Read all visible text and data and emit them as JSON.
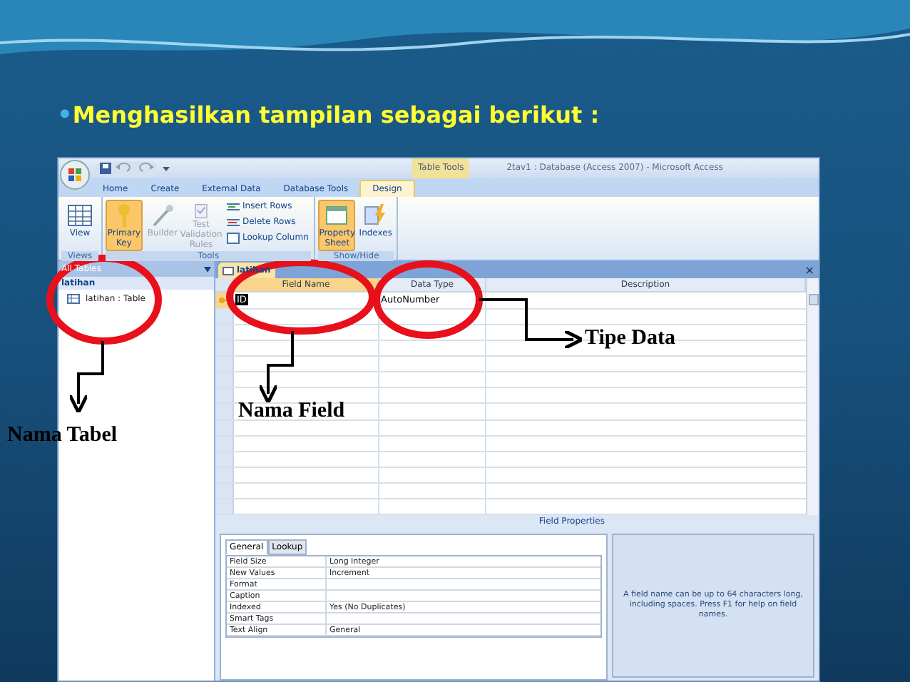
{
  "slide": {
    "bullet": "•",
    "title": "Menghasilkan tampilan sebagai berikut :"
  },
  "window": {
    "context_tab": "Table Tools",
    "title": "2tav1 : Database (Access 2007) - Microsoft Access"
  },
  "ribbon_tabs": [
    {
      "label": "Home",
      "selected": false
    },
    {
      "label": "Create",
      "selected": false
    },
    {
      "label": "External Data",
      "selected": false
    },
    {
      "label": "Database Tools",
      "selected": false
    },
    {
      "label": "Design",
      "selected": true
    }
  ],
  "ribbon_groups": [
    {
      "label": "Views",
      "buttons": [
        {
          "kind": "large",
          "label": "View",
          "active": false,
          "disabled": false
        }
      ]
    },
    {
      "label": "Tools",
      "buttons": [
        {
          "kind": "large",
          "label": "Primary Key",
          "active": true,
          "disabled": false
        },
        {
          "kind": "large",
          "label": "Builder",
          "active": false,
          "disabled": true
        },
        {
          "kind": "large",
          "label": "Test Validation Rules",
          "active": false,
          "disabled": true
        },
        {
          "kind": "small",
          "label": "Insert Rows",
          "active": false,
          "disabled": false
        },
        {
          "kind": "small",
          "label": "Delete Rows",
          "active": false,
          "disabled": false
        },
        {
          "kind": "small",
          "label": "Lookup Column",
          "active": false,
          "disabled": false
        }
      ]
    },
    {
      "label": "Show/Hide",
      "buttons": [
        {
          "kind": "large",
          "label": "Property Sheet",
          "active": true,
          "disabled": false
        },
        {
          "kind": "large",
          "label": "Indexes",
          "active": false,
          "disabled": false
        }
      ]
    }
  ],
  "nav_pane": {
    "header": "All Tables",
    "group": "latihan",
    "items": [
      {
        "label": "latihan : Table"
      }
    ]
  },
  "document_tab": {
    "label": "latihan",
    "close": "×"
  },
  "design_grid": {
    "columns": [
      "Field Name",
      "Data Type",
      "Description"
    ],
    "rows": [
      {
        "field_name": "ID",
        "data_type": "AutoNumber",
        "primary_key": true,
        "selected": true
      }
    ]
  },
  "field_properties": {
    "title": "Field Properties",
    "tabs": [
      {
        "label": "General",
        "selected": true
      },
      {
        "label": "Lookup",
        "selected": false
      }
    ],
    "properties": [
      {
        "name": "Field Size",
        "value": "Long Integer"
      },
      {
        "name": "New Values",
        "value": "Increment"
      },
      {
        "name": "Format"
      },
      {
        "name": "Caption"
      },
      {
        "name": "Indexed",
        "value": "Yes (No Duplicates)"
      },
      {
        "name": "Smart Tags"
      },
      {
        "name": "Text Align",
        "value": "General"
      }
    ],
    "help": "A field name can be up to 64 characters long, including spaces.  Press F1 for help on field names."
  },
  "annotations": [
    {
      "label": "Nama Tabel"
    },
    {
      "label": "Nama Field"
    },
    {
      "label": "Tipe Data"
    }
  ]
}
